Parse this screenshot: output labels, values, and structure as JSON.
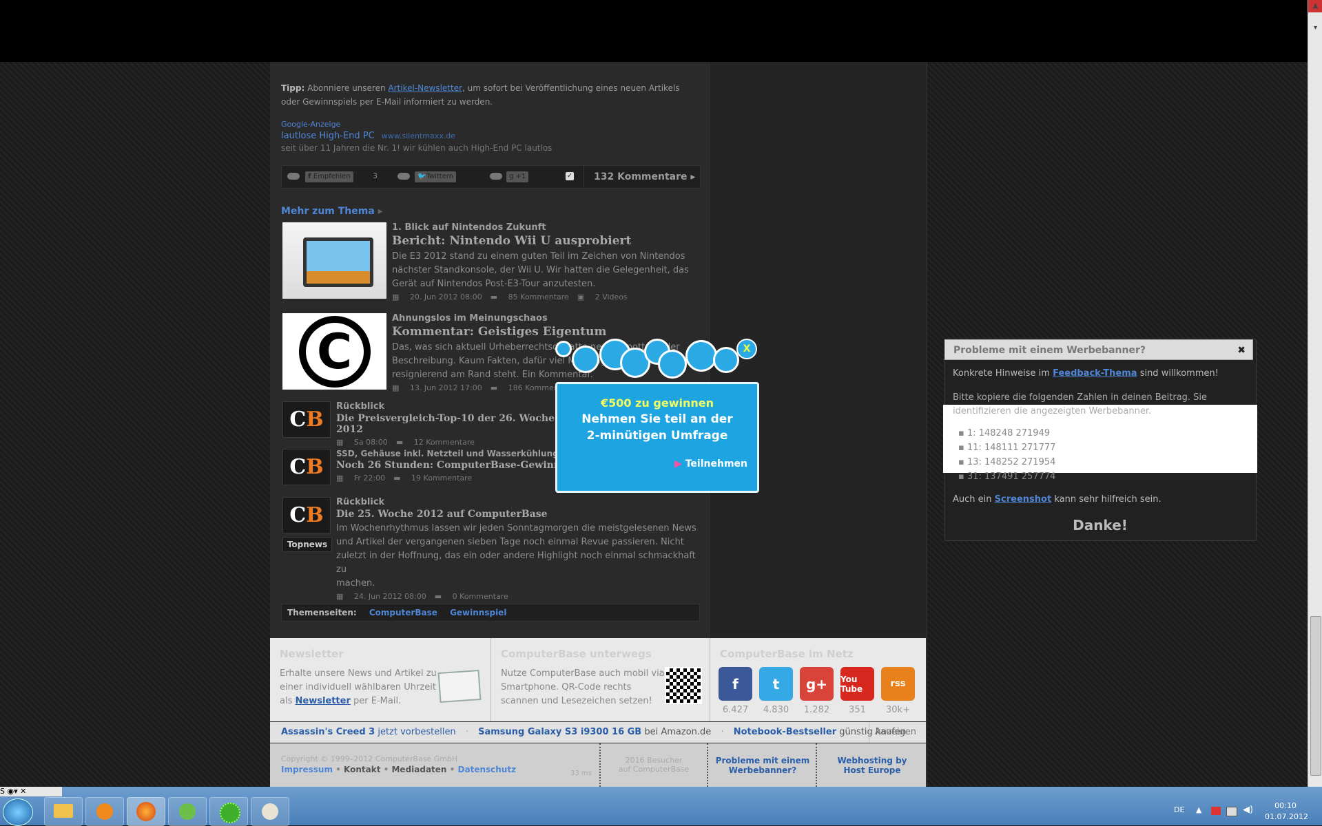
{
  "article_tip": {
    "label": "Tipp:",
    "text_before": "Abonniere unseren",
    "link": "Artikel-Newsletter",
    "text_after": ", um sofort bei Veröffentlichung eines neuen Artikels",
    "text_line2": "oder Gewinnspiels per E-Mail informiert zu werden."
  },
  "google_ad": {
    "label": "Google-Anzeige",
    "title": "lautlose High-End PC",
    "url": "www.silentmaxx.de",
    "text": "seit über 11 Jahren die Nr. 1! wir kühlen auch High-End PC lautlos"
  },
  "share_bar": {
    "facebook_label": "Empfehlen",
    "facebook_count": "3",
    "twitter_label": "Twittern",
    "gplus_label": "+1",
    "comments_label": "132 Kommentare"
  },
  "related": {
    "heading": "Mehr zum Thema",
    "items": [
      {
        "kicker": "1. Blick auf Nintendos Zukunft",
        "title": "Bericht: Nintendo Wii U ausprobiert",
        "desc": [
          "Die E3 2012 stand zu einem guten Teil im Zeichen von Nintendos",
          "nächster Standkonsole, der Wii U. Wir hatten die Gelegenheit, das",
          "Gerät auf Nintendos Post-E3-Tour anzutesten."
        ],
        "date": "20. Jun 2012 08:00",
        "comments": "85 Kommentare",
        "extra": "2 Videos"
      },
      {
        "kicker": "Ahnungslos im Meinungschaos",
        "title": "Kommentar: Geistiges Eigentum",
        "desc": [
          "Das, was sich aktuell Urheberrechtsdebatte nennt, spottet jeder",
          "Beschreibung. Kaum Fakten, dafür viel Meinung. Die Künstler stehen",
          "resignierend am Rand steht. Ein Kommentar."
        ],
        "date": "13. Jun 2012 17:00",
        "comments": "186 Kommentare"
      },
      {
        "kicker": "Rückblick",
        "title": "Die Preisvergleich-Top-10 der 26. Woche 2012",
        "date": "Sa 08:00",
        "comments": "12 Kommentare"
      },
      {
        "kicker": "SSD, Gehäuse inkl. Netzteil und Wasserkühlung v",
        "title": "Noch 26 Stunden: ComputerBase-Gewinnspiel",
        "date": "Fr 22:00",
        "comments": "19 Kommentare"
      },
      {
        "kicker": "Rückblick",
        "title": "Die 25. Woche 2012 auf ComputerBase",
        "desc": [
          "Im Wochenrhythmus lassen wir jeden Sonntagmorgen die meistgelesenen News",
          "und Artikel der vergangenen sieben Tage noch einmal Revue passieren. Nicht",
          "zuletzt in der Hoffnung, das ein oder andere Highlight noch einmal schmackhaft zu",
          "machen."
        ],
        "date": "24. Jun 2012 08:00",
        "comments": "0 Kommentare",
        "badge": "Topnews"
      }
    ]
  },
  "themes": {
    "label": "Themenseiten:",
    "links": [
      "ComputerBase",
      "Gewinnspiel"
    ]
  },
  "footer": {
    "newsletter": {
      "title": "Newsletter",
      "lines": [
        "Erhalte unsere News und Artikel zu",
        "einer individuell wählbaren Uhrzeit"
      ],
      "line3_before": "als",
      "link": "Newsletter",
      "line3_after": "per E-Mail."
    },
    "mobile": {
      "title": "ComputerBase unterwegs",
      "lines": [
        "Nutze ComputerBase auch mobil via",
        "Smartphone. QR-Code rechts",
        "scannen und Lesezeichen setzen!"
      ]
    },
    "social": {
      "title": "ComputerBase im Netz",
      "counts": [
        "6.427",
        "4.830",
        "1.282",
        "351",
        "30k+"
      ],
      "labels": [
        "f",
        "t",
        "g+",
        "You Tube",
        "rss"
      ]
    }
  },
  "adline": {
    "items": [
      {
        "bold": "Assassin's Creed 3",
        "rest": "jetzt vorbestellen"
      },
      {
        "bold": "Samsung Galaxy S3 i9300 16 GB",
        "rest": "bei Amazon.de"
      },
      {
        "bold": "Notebook-Bestseller",
        "rest": "günstig kaufen"
      }
    ],
    "anzeigen": "Anzeigen"
  },
  "copyright": {
    "text": "Copyright © 1999–2012 ComputerBase GmbH",
    "links": [
      "Impressum",
      "Kontakt",
      "Mediadaten",
      "Datenschutz"
    ],
    "time": "33 ms",
    "visitors_line1": "2016 Besucher",
    "visitors_line2": "auf ComputerBase",
    "ad_problems": [
      "Probleme mit einem",
      "Werbebanner?"
    ],
    "hosting": [
      "Webhosting by",
      "Host Europe"
    ]
  },
  "ad_box": {
    "title": "Probleme mit einem Werbebanner?",
    "intro_before": "Konkrete Hinweise im",
    "intro_link": "Feedback-Thema",
    "intro_after": "sind willkommen!",
    "copy_line1": "Bitte kopiere die folgenden Zahlen in deinen Beitrag. Sie",
    "copy_line2": "identifizieren die angezeigten Werbebanner.",
    "numbers": [
      "1: 148248 271949",
      "11: 148111 271777",
      "13: 148252 271954",
      "31: 137491 257774"
    ],
    "screenshot_before": "Auch ein",
    "screenshot_link": "Screenshot",
    "screenshot_after": "kann sehr hilfreich sein.",
    "thanks": "Danke!"
  },
  "survey": {
    "line1": "€500 zu gewinnen",
    "line2": "Nehmen Sie teil an der",
    "line3": "2-minütigen Umfrage",
    "cta": "Teilnehmen",
    "close": "X"
  },
  "taskbar": {
    "language": "DE",
    "time": "00:10",
    "date": "01.07.2012"
  },
  "colors": {
    "link": "#4f86d6",
    "accent_orange": "#ee7a22",
    "survey_blue": "#1ea4e0"
  }
}
